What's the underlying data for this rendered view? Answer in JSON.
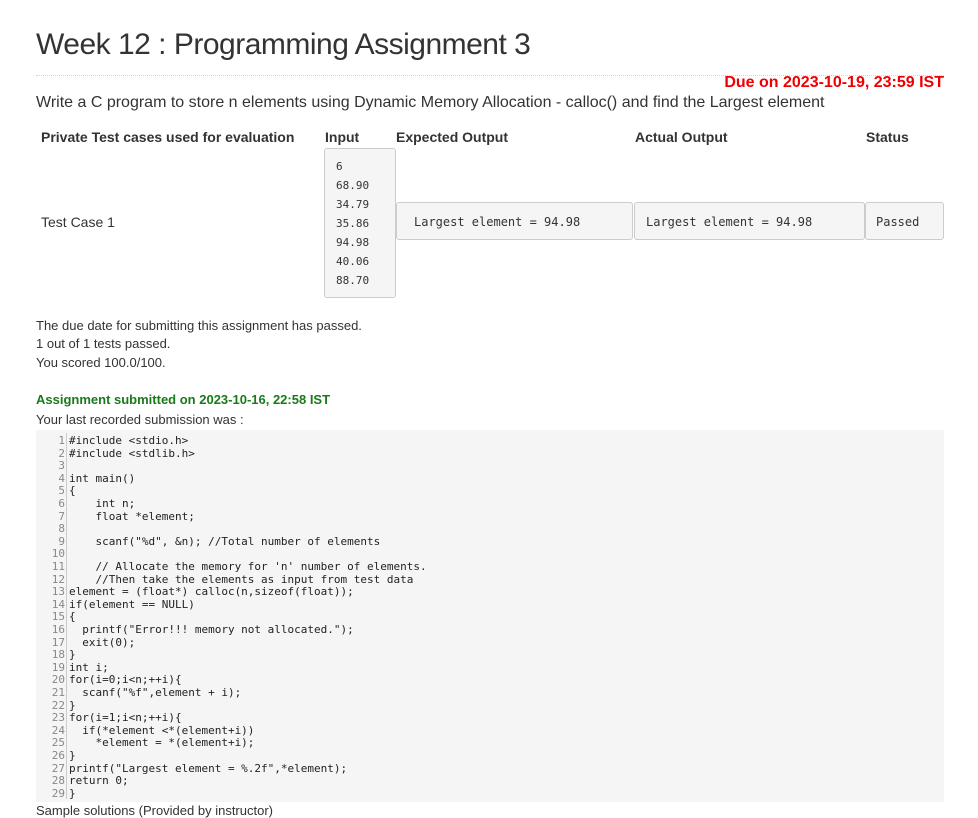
{
  "page": {
    "title": "Week 12 : Programming Assignment 3",
    "due": "Due on 2023-10-19, 23:59 IST",
    "description": "Write a C program to store n elements using Dynamic Memory Allocation - calloc() and find the Largest element"
  },
  "table": {
    "headers": {
      "private": "Private Test cases used for evaluation",
      "input": "Input",
      "expected": "Expected Output",
      "actual": "Actual Output",
      "status": "Status"
    },
    "rows": [
      {
        "name": "Test Case 1",
        "input_lines": [
          "6",
          "68.90",
          "34.79",
          "35.86",
          "94.98",
          "40.06",
          "88.70"
        ],
        "expected": "Largest element = 94.98",
        "actual": "Largest element = 94.98",
        "status": "Passed"
      }
    ]
  },
  "results": {
    "due_passed": "The due date for submitting this assignment has passed.",
    "tests_passed": "1 out of 1 tests passed.",
    "score": "You scored 100.0/100."
  },
  "submission": {
    "submitted_on": "Assignment submitted on 2023-10-16, 22:58 IST",
    "last_recorded": "Your last recorded submission was :",
    "code_lines": [
      "#include <stdio.h>",
      "#include <stdlib.h>",
      "",
      "int main()",
      "{",
      "    int n;",
      "    float *element;",
      "",
      "    scanf(\"%d\", &n); //Total number of elements",
      "",
      "    // Allocate the memory for 'n' number of elements.",
      "    //Then take the elements as input from test data",
      "element = (float*) calloc(n,sizeof(float));",
      "if(element == NULL)",
      "{",
      "  printf(\"Error!!! memory not allocated.\");",
      "  exit(0);",
      "}",
      "int i;",
      "for(i=0;i<n;++i){",
      "  scanf(\"%f\",element + i);",
      "}",
      "for(i=1;i<n;++i){",
      "  if(*element <*(element+i))",
      "    *element = *(element+i);",
      "}",
      "printf(\"Largest element = %.2f\",*element);",
      "return 0;",
      "}"
    ],
    "sample_solutions": "Sample solutions (Provided by instructor)"
  }
}
